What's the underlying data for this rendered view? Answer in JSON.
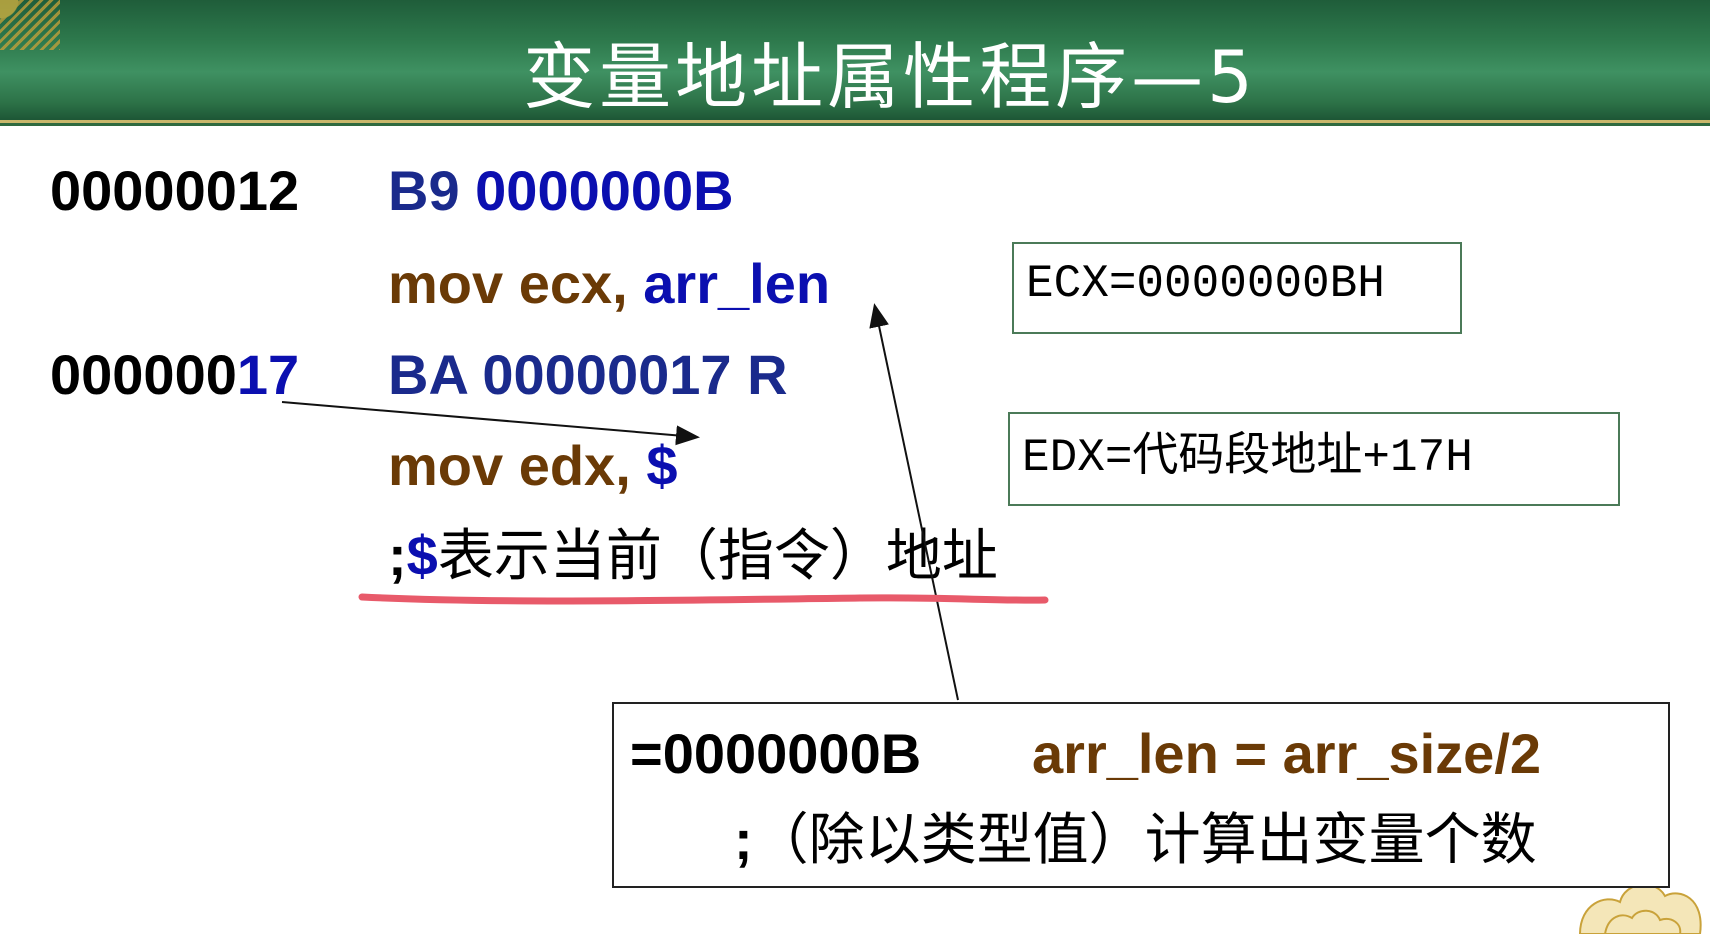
{
  "slide": {
    "title": "变量地址属性程序—5"
  },
  "listing": {
    "line1": {
      "address": "00000012",
      "opcode": "B9",
      "operand": "0000000B"
    },
    "line2": {
      "mnemonic": "mov ecx, ",
      "operand": "arr_len"
    },
    "line3": {
      "address_prefix": "000000",
      "address_suffix": "17",
      "opcode": "BA 00000017 R"
    },
    "line4": {
      "mnemonic": "mov edx, ",
      "operand": "$"
    },
    "line5": {
      "semicolon": ";",
      "dollar": "$",
      "comment": "表示当前（指令）地址"
    }
  },
  "boxes": {
    "ecx": "ECX=0000000BH",
    "edx": "EDX=代码段地址+17H"
  },
  "note": {
    "value": "=0000000B",
    "expression": "arr_len = arr_size/2",
    "comment_prefix": ";",
    "comment": "（除以类型值）计算出变量个数"
  },
  "colors": {
    "header_green": "#2e7a4d",
    "code_blue": "#0b0fb0",
    "code_brown": "#6a3a06",
    "underline_red": "#e85a6a"
  }
}
